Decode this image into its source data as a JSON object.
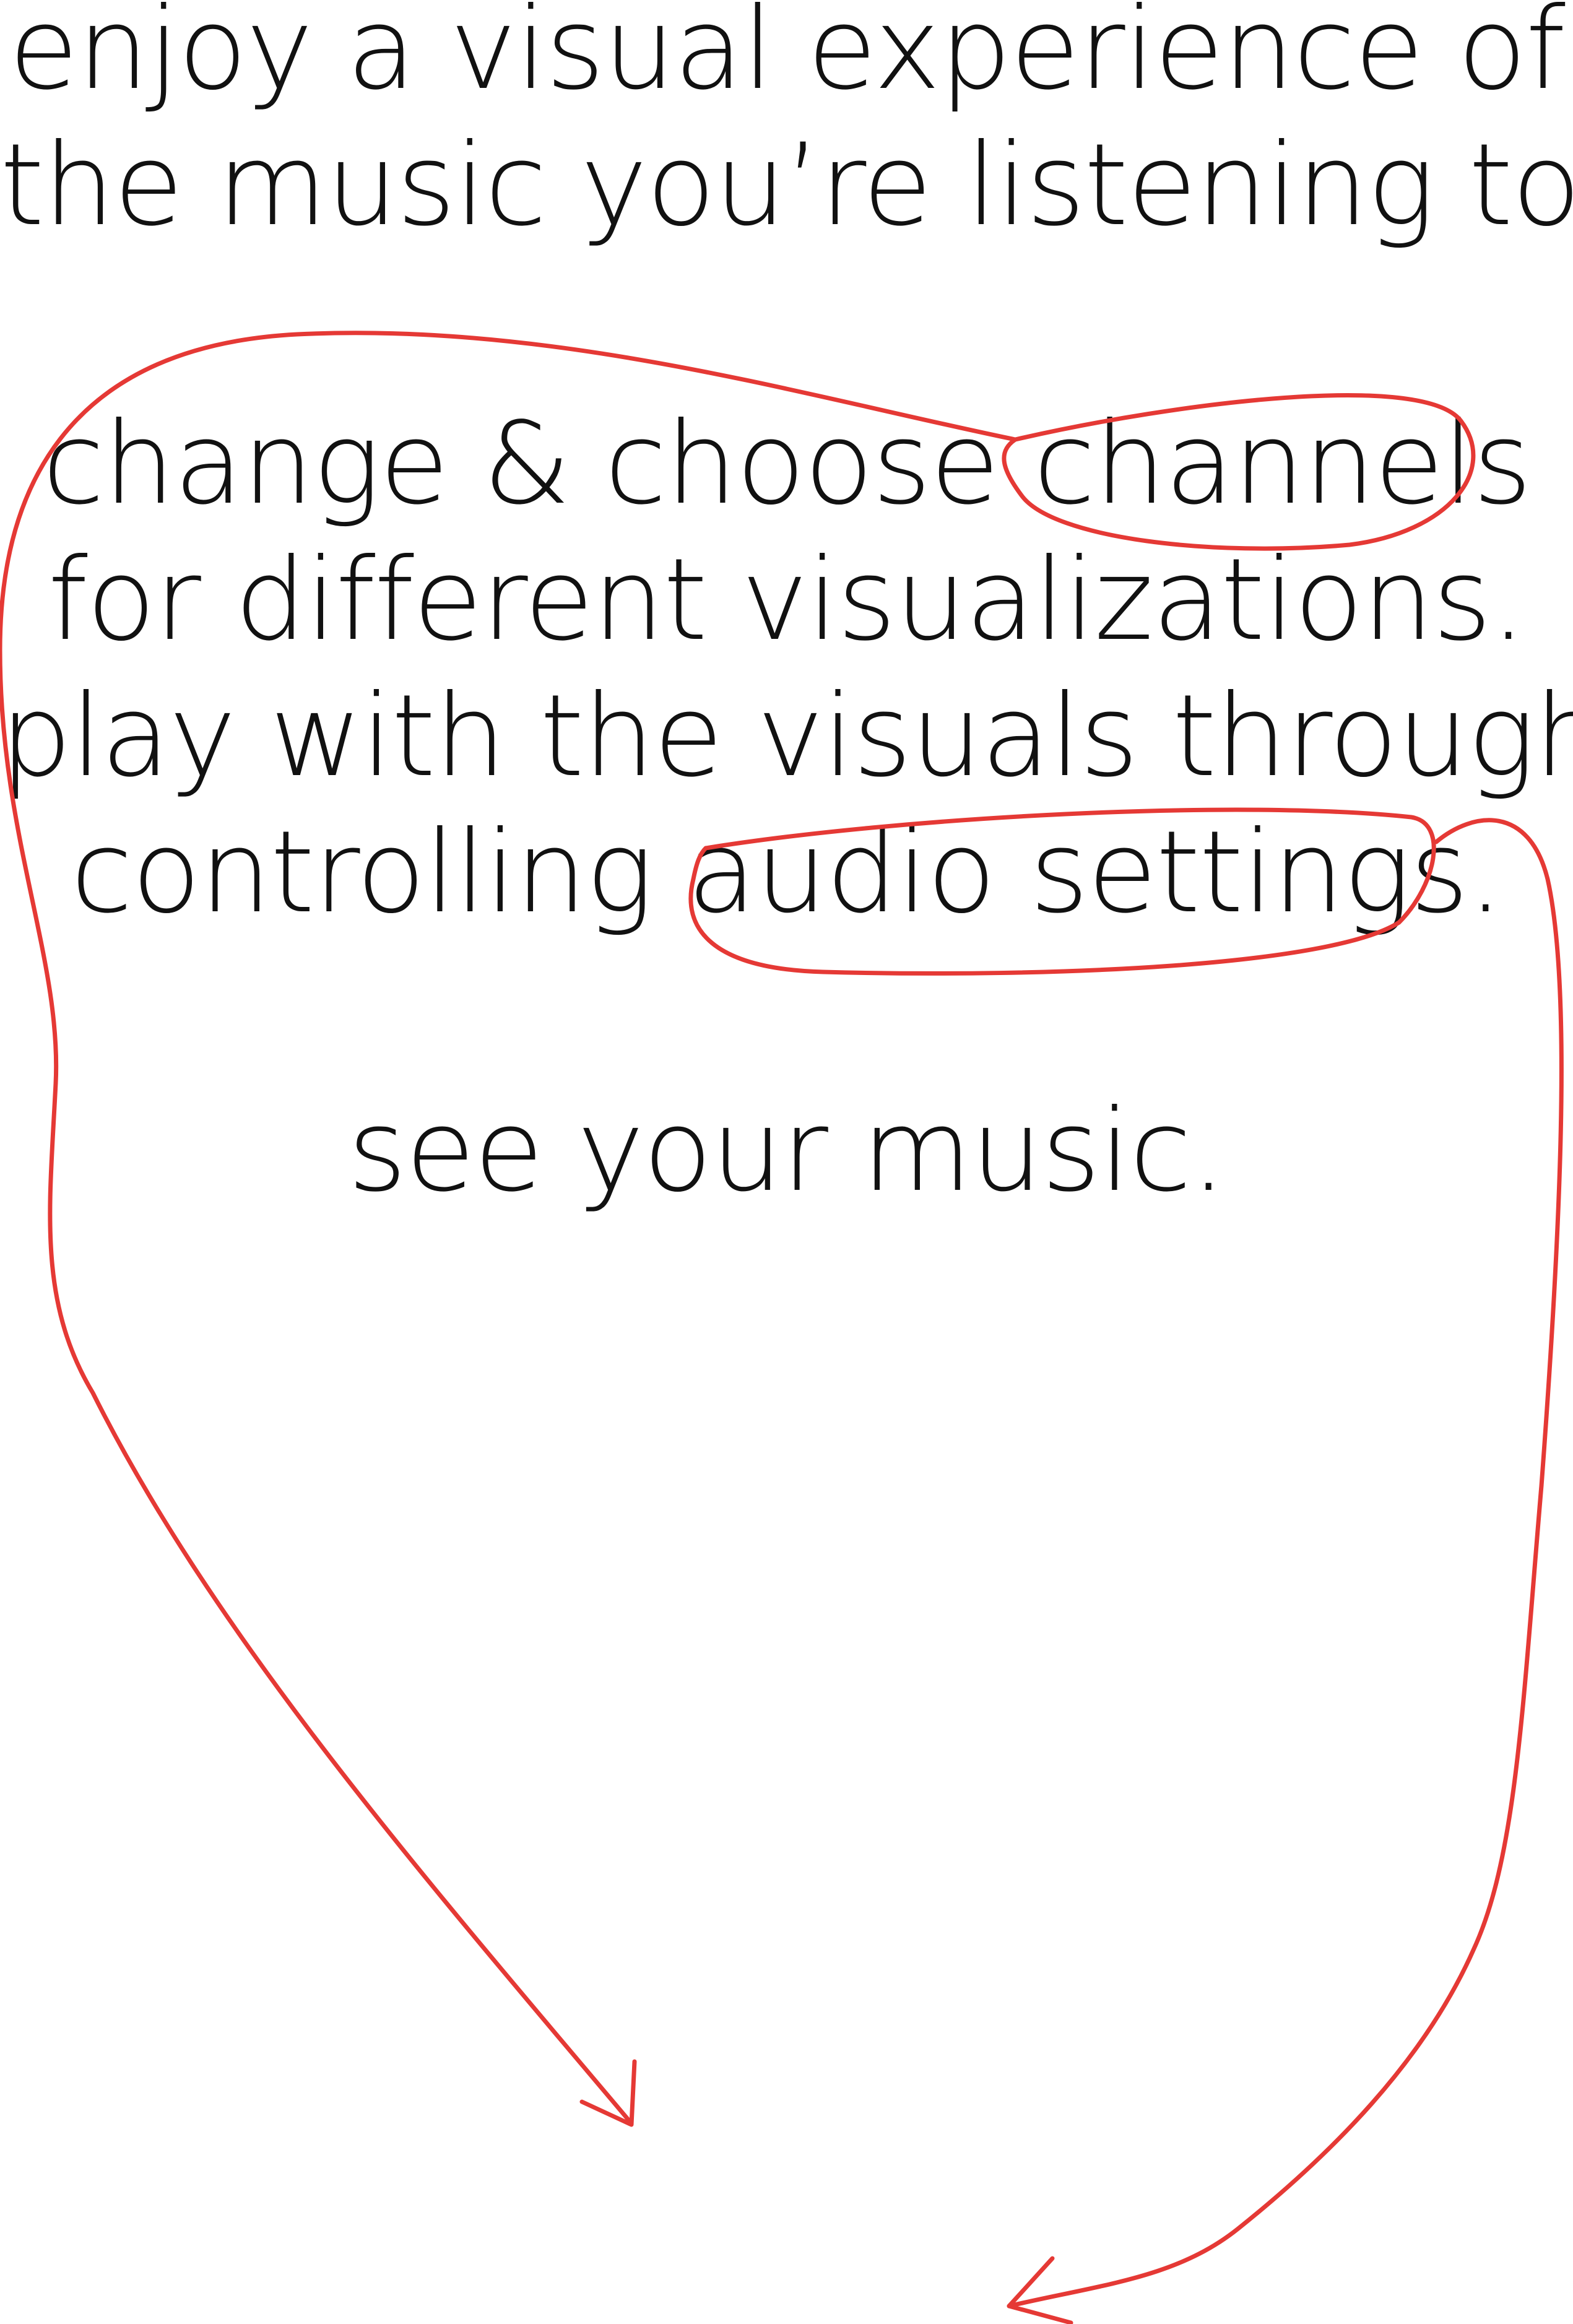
{
  "intro": {
    "line1": "enjoy a visual experience of",
    "line2": "the music you’re listening to."
  },
  "features": {
    "line1_prefix": "change & choose ",
    "line1_highlight": "channels",
    "line2": "for different visualizations.",
    "line3": "play with the visuals through",
    "line4_prefix": "controlling ",
    "line4_highlight": "audio settings",
    "line4_suffix": "."
  },
  "closing": {
    "line1": "see your music."
  },
  "colors": {
    "text": "#111111",
    "annotation": "#e53935",
    "background": "#ffffff"
  }
}
